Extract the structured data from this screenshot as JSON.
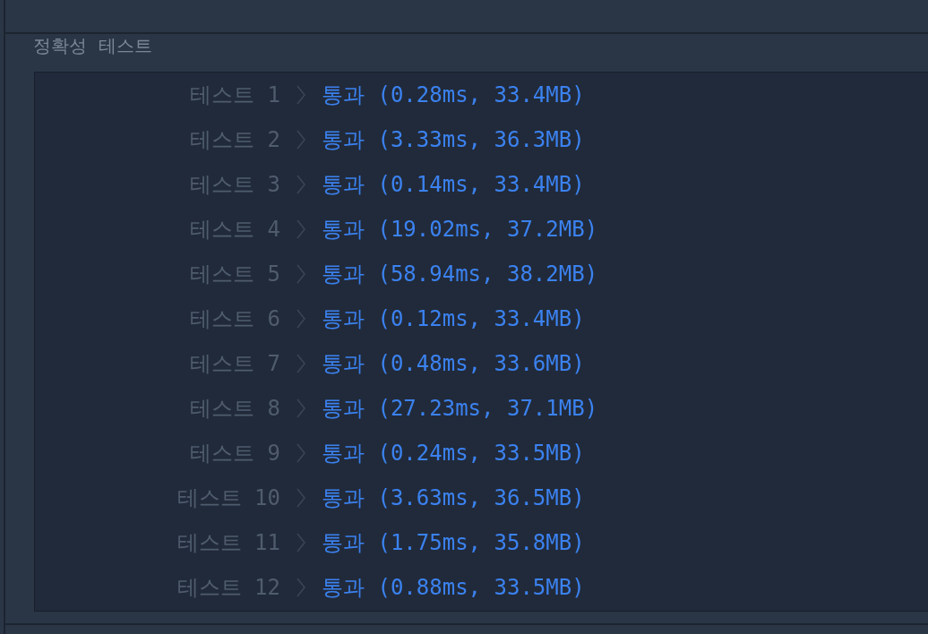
{
  "section_title": "정확성  테스트",
  "tests": [
    {
      "label": "테스트 1",
      "result": "통과 (0.28ms, 33.4MB)"
    },
    {
      "label": "테스트 2",
      "result": "통과 (3.33ms, 36.3MB)"
    },
    {
      "label": "테스트 3",
      "result": "통과 (0.14ms, 33.4MB)"
    },
    {
      "label": "테스트 4",
      "result": "통과 (19.02ms, 37.2MB)"
    },
    {
      "label": "테스트 5",
      "result": "통과 (58.94ms, 38.2MB)"
    },
    {
      "label": "테스트 6",
      "result": "통과 (0.12ms, 33.4MB)"
    },
    {
      "label": "테스트 7",
      "result": "통과 (0.48ms, 33.6MB)"
    },
    {
      "label": "테스트 8",
      "result": "통과 (27.23ms, 37.1MB)"
    },
    {
      "label": "테스트 9",
      "result": "통과 (0.24ms, 33.5MB)"
    },
    {
      "label": "테스트 10",
      "result": "통과 (3.63ms, 36.5MB)"
    },
    {
      "label": "테스트 11",
      "result": "통과 (1.75ms, 35.8MB)"
    },
    {
      "label": "테스트 12",
      "result": "통과 (0.88ms, 33.5MB)"
    }
  ]
}
